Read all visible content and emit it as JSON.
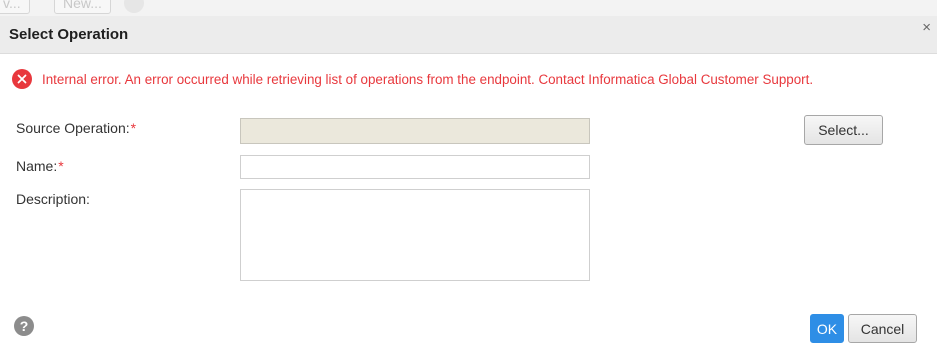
{
  "background": {
    "tabs": [
      "v...",
      "New..."
    ]
  },
  "dialog": {
    "title": "Select Operation",
    "close_symbol": "×"
  },
  "error": {
    "icon": "error-x-icon",
    "color": "#e8383d",
    "message": "Internal error. An error occurred while retrieving list of operations from the endpoint. Contact Informatica Global Customer Support."
  },
  "form": {
    "source_operation": {
      "label": "Source Operation:",
      "required_mark": "*",
      "value": ""
    },
    "name": {
      "label": "Name:",
      "required_mark": "*",
      "value": ""
    },
    "description": {
      "label": "Description:",
      "value": ""
    },
    "select_button": "Select..."
  },
  "footer": {
    "help_symbol": "?",
    "ok_label": "OK",
    "cancel_label": "Cancel",
    "ok_color": "#2e8ee6"
  }
}
